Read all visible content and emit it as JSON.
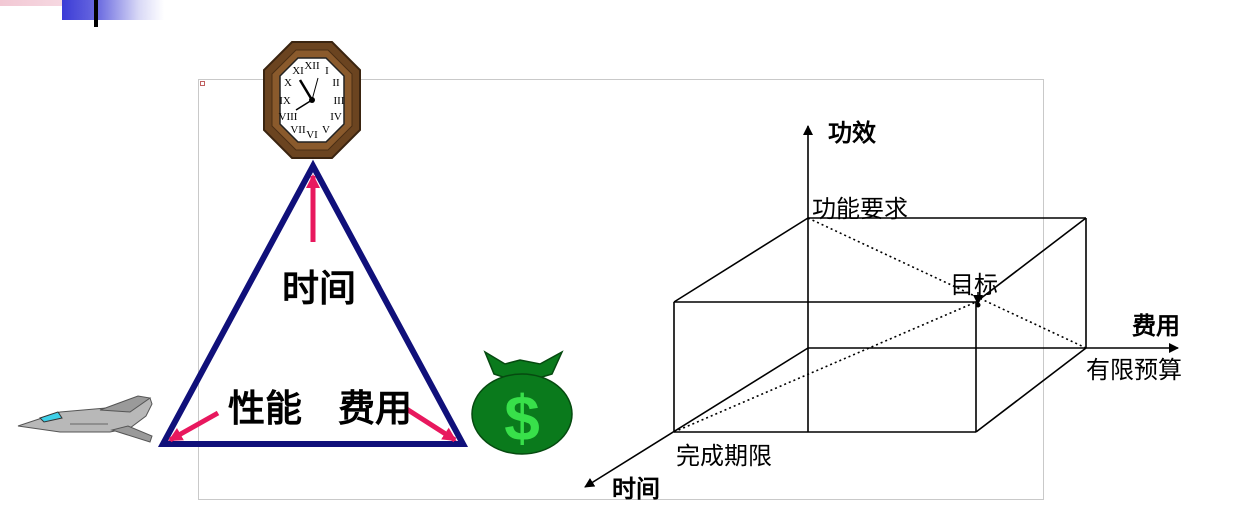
{
  "triangle": {
    "time_label": "时间",
    "performance_label": "性能",
    "cost_label": "费用"
  },
  "axes": {
    "y_label": "功效",
    "x_label": "费用",
    "z_label": "时间"
  },
  "points": {
    "function_requirement": "功能要求",
    "limited_budget": "有限预算",
    "completion_deadline": "完成期限",
    "target": "目标"
  },
  "colors": {
    "triangle_stroke": "#10107a",
    "arrow_pink": "#e8185e",
    "money_green": "#0a7a1c",
    "dollar_green": "#38e04a",
    "clock_wood": "#6b4420"
  },
  "icons": [
    "clock-icon",
    "jet-fighter-icon",
    "money-bag-icon"
  ]
}
